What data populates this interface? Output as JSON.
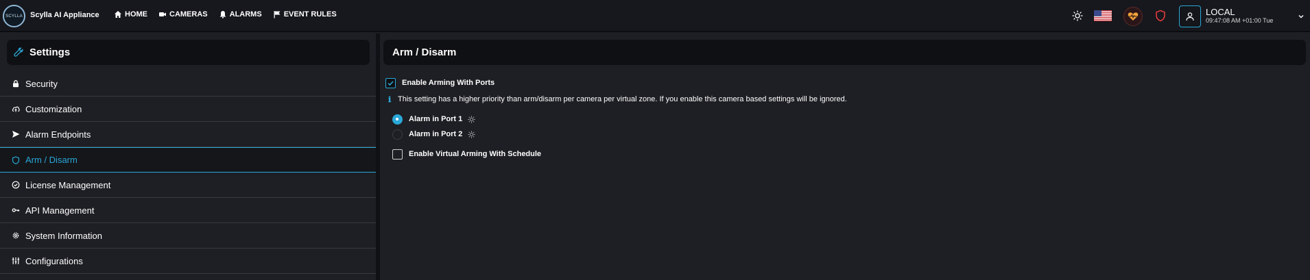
{
  "app": {
    "logo_text": "SCYLLA",
    "title": "Scylla AI Appliance"
  },
  "nav": {
    "items": [
      {
        "label": "HOME",
        "icon": "home-icon"
      },
      {
        "label": "CAMERAS",
        "icon": "camera-icon"
      },
      {
        "label": "ALARMS",
        "icon": "bell-icon"
      },
      {
        "label": "EVENT RULES",
        "icon": "flag-icon"
      }
    ]
  },
  "user": {
    "name": "LOCAL",
    "time": "09:47:08 AM +01:00 Tue"
  },
  "sidebar": {
    "title": "Settings",
    "items": [
      {
        "label": "Security",
        "icon": "lock-icon"
      },
      {
        "label": "Customization",
        "icon": "cloud-icon"
      },
      {
        "label": "Alarm Endpoints",
        "icon": "send-icon"
      },
      {
        "label": "Arm / Disarm",
        "icon": "shield-icon",
        "active": true
      },
      {
        "label": "License Management",
        "icon": "check-circle-icon"
      },
      {
        "label": "API Management",
        "icon": "key-icon"
      },
      {
        "label": "System Information",
        "icon": "gear-icon"
      },
      {
        "label": "Configurations",
        "icon": "sliders-icon"
      }
    ]
  },
  "main": {
    "title": "Arm / Disarm",
    "enable_arming_label": "Enable Arming With Ports",
    "enable_arming_checked": true,
    "info_text": "This setting has a higher priority than arm/disarm per camera per virtual zone. If you enable this camera based settings will be ignored.",
    "ports": [
      {
        "label": "Alarm in Port 1",
        "selected": true
      },
      {
        "label": "Alarm in Port 2",
        "selected": false
      }
    ],
    "virtual_arming_label": "Enable Virtual Arming With Schedule",
    "virtual_arming_checked": false
  },
  "colors": {
    "accent": "#2aa8d8",
    "background": "#1e1f24",
    "header": "#0f1013",
    "shield_red": "#e03a3a"
  }
}
